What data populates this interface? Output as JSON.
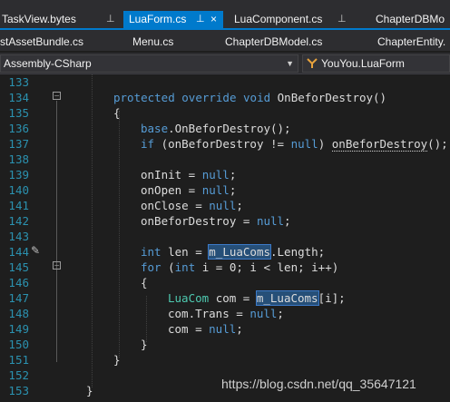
{
  "tabs_row1": [
    {
      "label": "TaskView.bytes",
      "pin": "pin-icon",
      "active": false
    },
    {
      "label": "LuaForm.cs",
      "pin": "pin-icon",
      "active": true,
      "close": "×"
    },
    {
      "label": "LuaComponent.cs",
      "pin": "pin-icon",
      "active": false
    },
    {
      "label": "ChapterDBMo",
      "active": false
    }
  ],
  "tabs_row2": [
    {
      "label": "stAssetBundle.cs"
    },
    {
      "label": "Menu.cs"
    },
    {
      "label": "ChapterDBModel.cs"
    },
    {
      "label": "ChapterEntity."
    }
  ],
  "navbar": {
    "project": "Assembly-CSharp",
    "member": "YouYou.LuaForm"
  },
  "colors": {
    "keyword": "#569cd6",
    "type": "#4ec9b0",
    "line_number": "#2b91af",
    "accent": "#007acc",
    "highlight": "#264f78"
  },
  "code": {
    "line_numbers": [
      "133",
      "134",
      "135",
      "136",
      "137",
      "138",
      "139",
      "140",
      "141",
      "142",
      "143",
      "144",
      "145",
      "146",
      "147",
      "148",
      "149",
      "150",
      "151",
      "152",
      "153"
    ],
    "l134": {
      "kw1": "protected",
      "kw2": "override",
      "kw3": "void",
      "rest": "OnBeforDestroy()"
    },
    "l135": {
      "text": "{"
    },
    "l136": {
      "kw": "base",
      "rest": ".OnBeforDestroy();"
    },
    "l137": {
      "kw1": "if",
      "mid": "(onBeforDestroy != ",
      "kw2": "null",
      "close": ")",
      "call": "onBeforDestroy",
      "end": "();"
    },
    "l139": {
      "pre": "onInit = ",
      "kw": "null",
      "end": ";"
    },
    "l140": {
      "pre": "onOpen = ",
      "kw": "null",
      "end": ";"
    },
    "l141": {
      "pre": "onClose = ",
      "kw": "null",
      "end": ";"
    },
    "l142": {
      "pre": "onBeforDestroy = ",
      "kw": "null",
      "end": ";"
    },
    "l144": {
      "kw": "int",
      "pre": "len = ",
      "hl": "m_LuaComs",
      "end": ".Length;"
    },
    "l145": {
      "kw1": "for",
      "p1": "(",
      "kw2": "int",
      "rest": "i = 0; i < len; i++)"
    },
    "l146": {
      "text": "{"
    },
    "l147": {
      "ty": "LuaCom",
      "pre": "com = ",
      "hl": "m_LuaComs",
      "end": "[i];"
    },
    "l148": {
      "pre": "com.Trans = ",
      "kw": "null",
      "end": ";"
    },
    "l149": {
      "pre": "com = ",
      "kw": "null",
      "end": ";"
    },
    "l150": {
      "text": "}"
    },
    "l151": {
      "text": "}"
    },
    "l153": {
      "text": "}"
    }
  },
  "watermark": "https://blog.csdn.net/qq_35647121"
}
